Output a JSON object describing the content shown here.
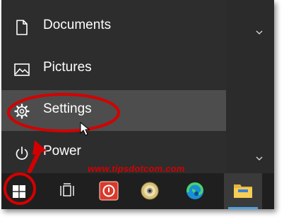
{
  "start_menu": {
    "items": [
      {
        "label": "Documents",
        "icon": "document-icon"
      },
      {
        "label": "Pictures",
        "icon": "pictures-icon"
      },
      {
        "label": "Settings",
        "icon": "gear-icon",
        "state": "hovered"
      },
      {
        "label": "Power",
        "icon": "power-icon"
      }
    ],
    "chevron_icons": [
      "chevron-down-icon",
      "chevron-down-icon"
    ]
  },
  "taskbar": {
    "items": [
      {
        "icon": "windows-start-icon"
      },
      {
        "icon": "task-view-icon"
      },
      {
        "icon": "red-power-app-icon"
      },
      {
        "icon": "cd-disc-icon"
      },
      {
        "icon": "edge-browser-icon"
      },
      {
        "icon": "file-explorer-icon",
        "state": "active"
      }
    ]
  },
  "watermark": "www.tipsdotcom.com",
  "annotation": {
    "color": "#d40000",
    "shapes": [
      "settings-highlight-ellipse",
      "start-button-circle",
      "pointer-arrow"
    ]
  },
  "colors": {
    "menu_bg": "#2d2d2d",
    "hover_bg": "#4d4d4d",
    "taskbar_bg": "#1f1f1f",
    "text": "#ffffff",
    "explorer_accent": "#4aa3e0"
  }
}
